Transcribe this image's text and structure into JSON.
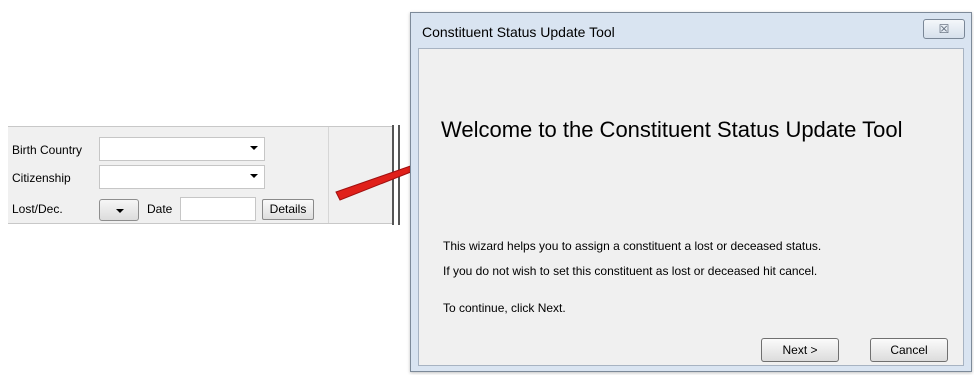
{
  "form": {
    "birth_country_label": "Birth Country",
    "birth_country_value": "",
    "citizenship_label": "Citizenship",
    "citizenship_value": "",
    "lost_dec_label": "Lost/Dec.",
    "lost_dec_value": "",
    "date_label": "Date",
    "date_value": "",
    "details_button": "Details"
  },
  "annotation": {
    "arrow_color": "#e0201a"
  },
  "dialog": {
    "title": "Constituent Status Update Tool",
    "close_glyph": "☒",
    "heading": "Welcome to the Constituent Status Update Tool",
    "line1": "This wizard helps you to assign a constituent a lost or deceased status.",
    "line2": "If you do not wish to set this constituent as lost or deceased hit cancel.",
    "line3": "To continue, click Next.",
    "next_button": "Next >",
    "cancel_button": "Cancel"
  }
}
